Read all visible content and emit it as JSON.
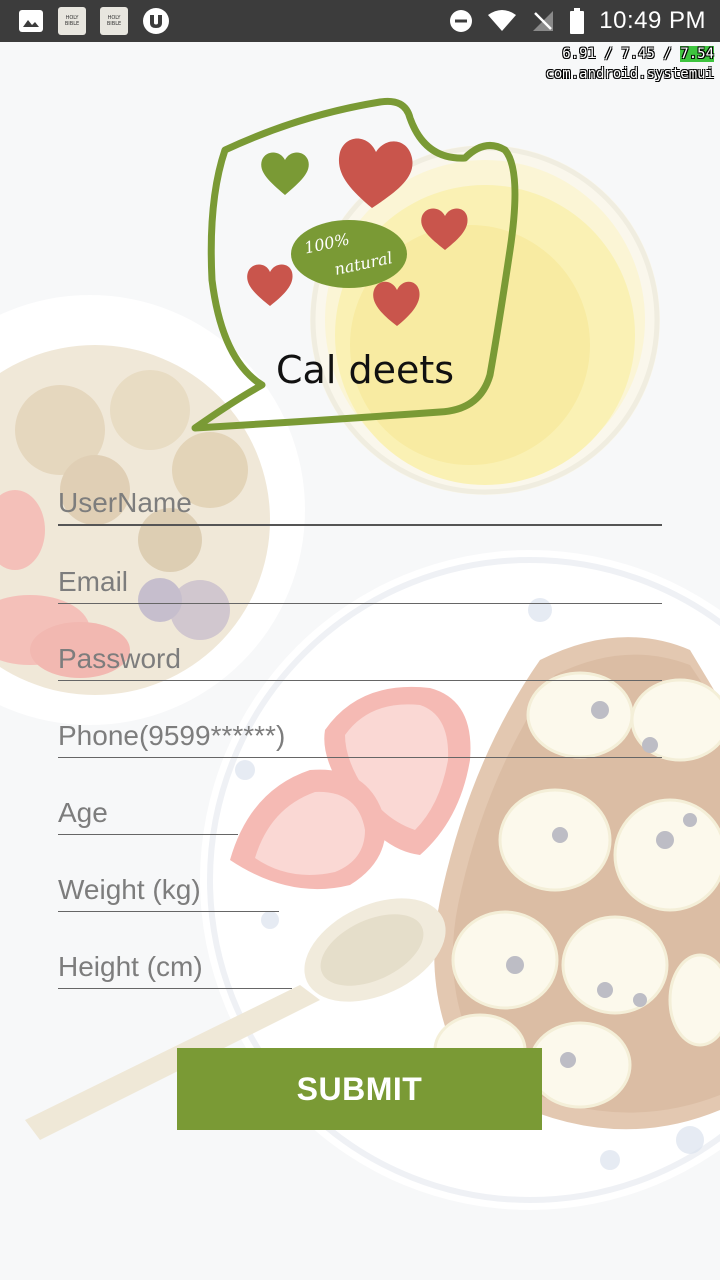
{
  "status_bar": {
    "time": "10:49 PM",
    "bible_icon_text": "HOLY BIBLE",
    "icons": [
      "image-icon",
      "bible-app-icon",
      "bible-app-icon",
      "utorrent-icon",
      "do-not-disturb-icon",
      "wifi-icon",
      "no-signal-icon",
      "battery-icon"
    ]
  },
  "debug_overlay": {
    "v1": "6.91",
    "sep1": " / ",
    "v2": "7.45",
    "sep2": " / ",
    "v3": "7.54",
    "process": "com.android.systemui"
  },
  "logo": {
    "title": "Cal deets",
    "badge_line1": "100%",
    "badge_line2": "natural",
    "colors": {
      "green": "#7a9a35",
      "heart": "#c9554c"
    }
  },
  "form": {
    "username_placeholder": "UserName",
    "email_placeholder": "Email",
    "password_placeholder": "Password",
    "phone_placeholder": "Phone(9599******)",
    "age_placeholder": "Age",
    "weight_placeholder": "Weight (kg)",
    "height_placeholder": "Height (cm)",
    "submit_label": "SUBMIT"
  }
}
